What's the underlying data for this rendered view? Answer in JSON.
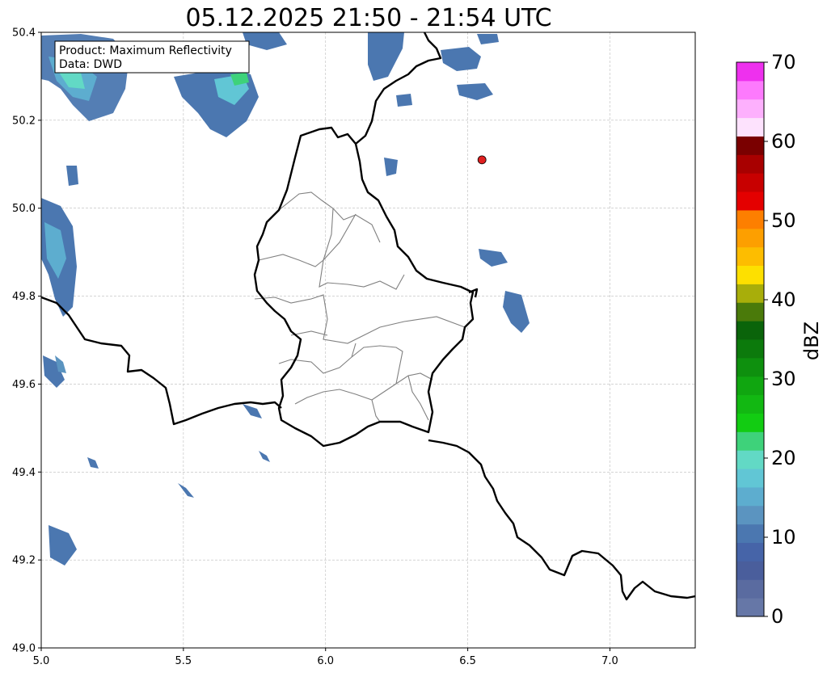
{
  "title": "05.12.2025 21:50 - 21:54 UTC",
  "info_box": {
    "product": "Product: Maximum Reflectivity",
    "data": "Data: DWD"
  },
  "map": {
    "xlim": [
      5.0,
      7.3
    ],
    "ylim": [
      49.0,
      50.4
    ],
    "x_ticks": [
      "5.0",
      "5.5",
      "6.0",
      "6.5",
      "7.0"
    ],
    "y_ticks": [
      "49.0",
      "49.2",
      "49.4",
      "49.6",
      "49.8",
      "50.0",
      "50.2",
      "50.4"
    ],
    "grid": true,
    "marker": {
      "lon": 6.55,
      "lat": 50.11,
      "color": "#e02020"
    }
  },
  "colorbar": {
    "label": "dBZ",
    "ticks": [
      "0",
      "10",
      "20",
      "30",
      "40",
      "50",
      "60",
      "70"
    ],
    "range": [
      0,
      70
    ],
    "colors": [
      "#6677a7",
      "#5a6ba0",
      "#4a5e9c",
      "#4664a8",
      "#4b77b0",
      "#5b94c0",
      "#5dadcf",
      "#61c6d5",
      "#62d9c5",
      "#3ed27a",
      "#12cc12",
      "#12b812",
      "#10a610",
      "#0e900e",
      "#0c7a0c",
      "#0a640a",
      "#4a7a0a",
      "#a8ae0a",
      "#fde000",
      "#fdbd00",
      "#fd9f00",
      "#fd7f00",
      "#e40000",
      "#c80000",
      "#a80000",
      "#7a0000",
      "#fde2fd",
      "#fdb0fd",
      "#fd7afd",
      "#ee30ee"
    ]
  },
  "legend": {
    "border_color": "#000000",
    "internal_color": "#808080",
    "grid_color": "#bbbbbb"
  }
}
